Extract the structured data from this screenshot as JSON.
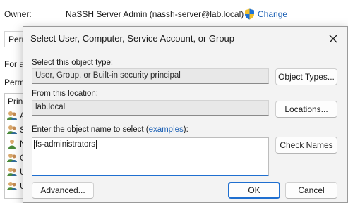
{
  "background": {
    "owner_label": "Owner:",
    "owner_value": "NaSSH Server Admin (nassh-server@lab.local)",
    "change_link": "Change",
    "tab_label": "Perm",
    "text_line1": "For a",
    "text_line2": "Perm",
    "list_header": "Prin",
    "rows": [
      {
        "initial": "A"
      },
      {
        "initial": "S"
      },
      {
        "initial": "N"
      },
      {
        "initial": "C"
      },
      {
        "initial": "U"
      },
      {
        "initial": "U"
      }
    ]
  },
  "dialog": {
    "title": "Select User, Computer, Service Account, or Group",
    "object_type_label": "Select this object type:",
    "object_type_value": "User, Group, or Built-in security principal",
    "object_types_button": "Object Types...",
    "location_label": "From this location:",
    "location_value": "lab.local",
    "locations_button": "Locations...",
    "enter_label_prefix": "E",
    "enter_label_rest": "nter the object name to select (",
    "examples_link": "examples",
    "enter_label_suffix": "):",
    "object_name_value": "fs-administrators",
    "check_names_button": "Check Names",
    "advanced_button": "Advanced...",
    "ok_button": "OK",
    "cancel_button": "Cancel"
  },
  "colors": {
    "accent": "#1f6fd0",
    "link": "#1a5fb4",
    "dialog_bg": "#f3f3f3"
  },
  "icons": [
    "shield-icon",
    "user-group-icon",
    "close-icon"
  ]
}
